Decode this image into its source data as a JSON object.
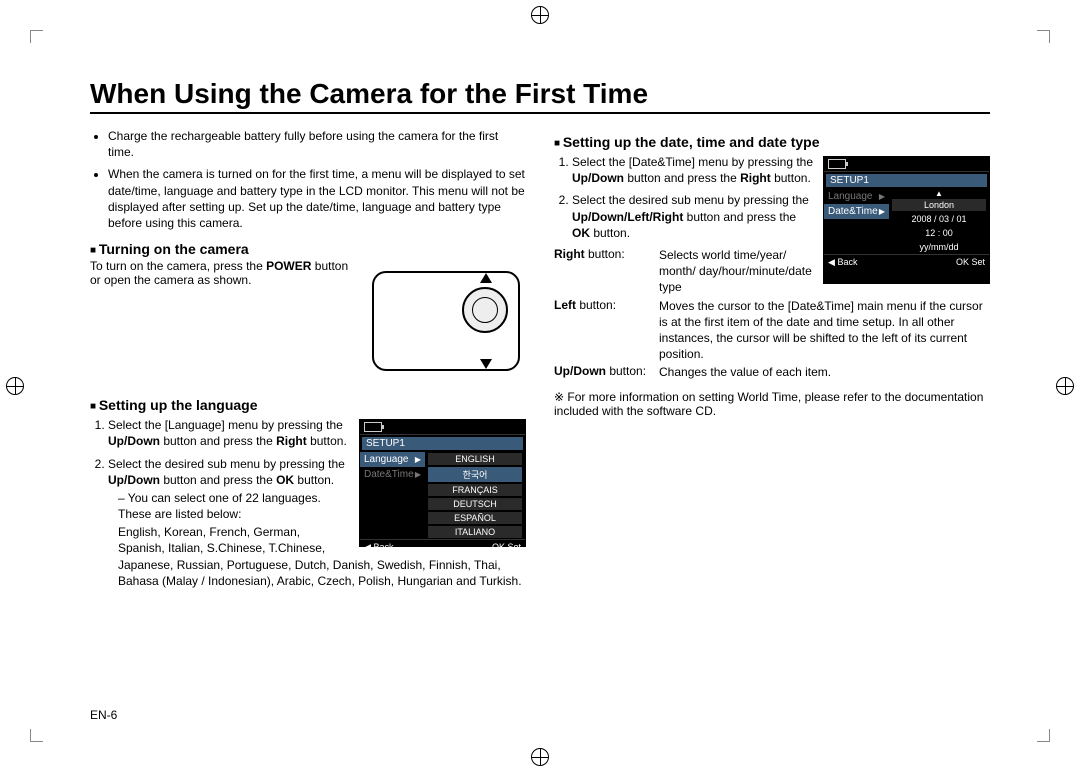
{
  "page_label": "EN-6",
  "title": "When Using the Camera for the First Time",
  "intro_bullets": [
    "Charge the rechargeable battery fully before using the camera for the first time.",
    "When the camera is turned on for the first time, a menu will be displayed to set date/time, language and battery type in the LCD monitor. This menu will not be displayed after setting up. Set up the date/time, language and battery type before using this camera."
  ],
  "turning_on": {
    "heading": "Turning on the camera",
    "text_pre": "To turn on the camera, press the ",
    "power_word": "POWER",
    "text_post": " button or open the camera as shown."
  },
  "language": {
    "heading": "Setting up the language",
    "step1_a": "Select the [Language] menu by pressing the ",
    "step1_b": "Up/Down",
    "step1_c": " button and press the ",
    "step1_d": "Right",
    "step1_e": " button.",
    "step2_a": "Select the desired sub menu by pressing the ",
    "step2_b": "Up/Down",
    "step2_c": " button and press the ",
    "step2_d": "OK",
    "step2_e": " button.",
    "sub_note": "You can select one of 22 languages. These are listed below:",
    "languages_list": "English, Korean, French, German, Spanish, Italian, S.Chinese, T.Chinese, Japanese, Russian, Portuguese, Dutch, Danish, Swedish, Finnish, Thai, Bahasa (Malay / Indonesian), Arabic, Czech, Polish, Hungarian and Turkish."
  },
  "datetime": {
    "heading": "Setting up the date, time and date type",
    "step1_a": "Select the [Date&Time] menu by pressing the ",
    "step1_b": "Up/Down",
    "step1_c": " button and press the ",
    "step1_d": "Right",
    "step1_e": " button.",
    "step2_a": "Select the desired sub menu by pressing the ",
    "step2_b": "Up/Down/Left/Right",
    "step2_c": " button and press the ",
    "step2_d": "OK",
    "step2_e": " button.",
    "right_label": "Right",
    "right_suffix": " button:",
    "right_desc": "Selects world time/year/ month/ day/hour/minute/date type",
    "left_label": "Left",
    "left_suffix": " button:",
    "left_desc": "Moves the cursor to the [Date&Time] main menu if the cursor is at the first item of the date and time setup. In all other instances, the cursor will be shifted to the left of its current position.",
    "updown_label": "Up/Down",
    "updown_suffix": " button:",
    "updown_desc": "Changes the value of each item."
  },
  "note_worldtime": "For more information on setting World Time, please refer to the documentation included with the software CD.",
  "lcd_lang": {
    "setup": "SETUP1",
    "menu_language": "Language",
    "menu_datetime": "Date&Time",
    "opts": [
      "ENGLISH",
      "한국어",
      "FRANÇAIS",
      "DEUTSCH",
      "ESPAÑOL",
      "ITALIANO"
    ],
    "back_icon": "◀",
    "back_label": "Back",
    "ok_label": "OK",
    "ok_action": "Set"
  },
  "lcd_date": {
    "setup": "SETUP1",
    "menu_language": "Language",
    "menu_datetime": "Date&Time",
    "city": "London",
    "date": "2008 / 03 / 01",
    "time": "12 : 00",
    "format": "yy/mm/dd",
    "back_icon": "◀",
    "back_label": "Back",
    "ok_label": "OK",
    "ok_action": "Set"
  }
}
